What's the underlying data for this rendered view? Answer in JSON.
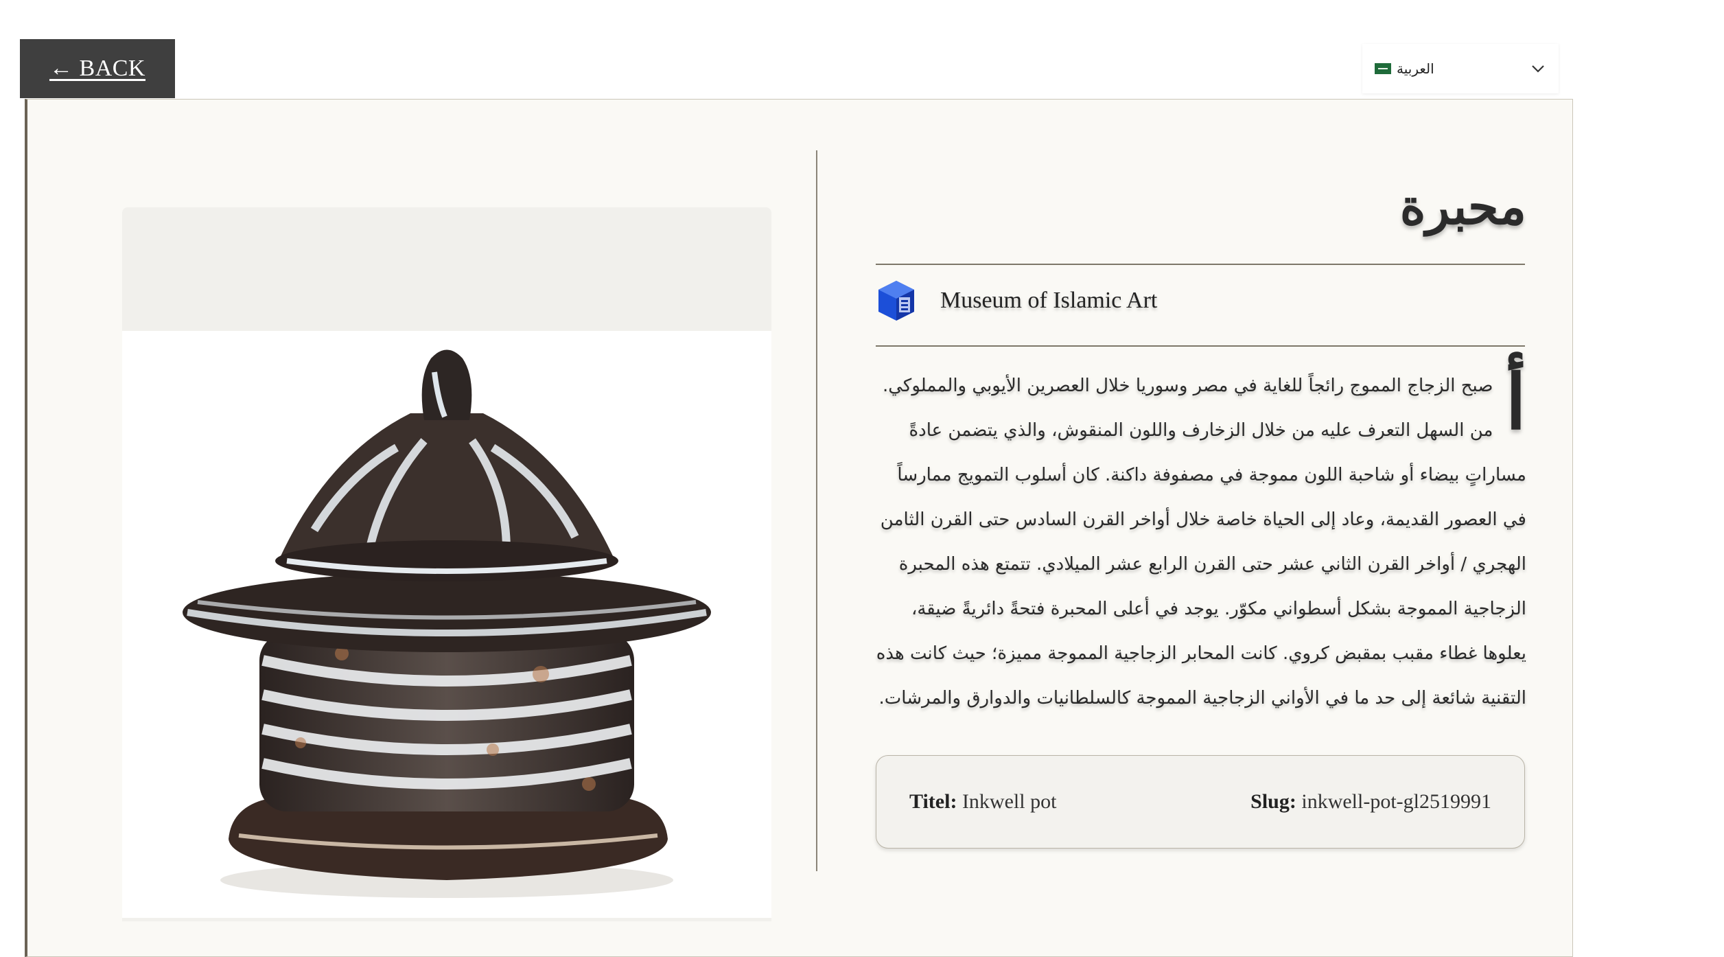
{
  "nav": {
    "back_label": "← BACK"
  },
  "language": {
    "selected": "العربية",
    "flag_icon": "saudi-flag-icon"
  },
  "artwork": {
    "title": "محبرة",
    "museum": "Museum of Islamic Art",
    "dropcap": "أ",
    "description": "صبح الزجاج المموج رائجاً للغاية في مصر وسوريا خلال العصرين الأيوبي والمملوكي. من السهل التعرف عليه من خلال الزخارف واللون المنقوش، والذي يتضمن عادةً مساراتٍ بيضاء أو شاحبة اللون مموجة في مصفوفة داكنة. كان أسلوب التمويج ممارساً في العصور القديمة، وعاد إلى الحياة خاصة خلال أواخر القرن السادس حتى القرن الثامن الهجري / أواخر القرن الثاني عشر حتى القرن الرابع عشر الميلادي. تتمتع هذه المحبرة الزجاجية المموجة بشكل أسطواني مكوّر. يوجد في أعلى المحبرة فتحةً دائريةً ضيقة، يعلوها غطاء مقبب بمقبض كروي. كانت المحابر الزجاجية المموجة مميزة؛ حيث كانت هذه التقنية شائعة إلى حد ما في الأواني الزجاجية المموجة كالسلطانيات والدوارق والمرشات.",
    "meta": {
      "title_label": "Titel:",
      "title_value": "Inkwell pot",
      "slug_label": "Slug:",
      "slug_value": "inkwell-pot-gl2519991"
    },
    "image_alt": "Inkwell pot"
  },
  "colors": {
    "card_bg": "#faf9f5",
    "back_bg": "#3f3f3f",
    "logo_blue": "#1c4fd8"
  }
}
